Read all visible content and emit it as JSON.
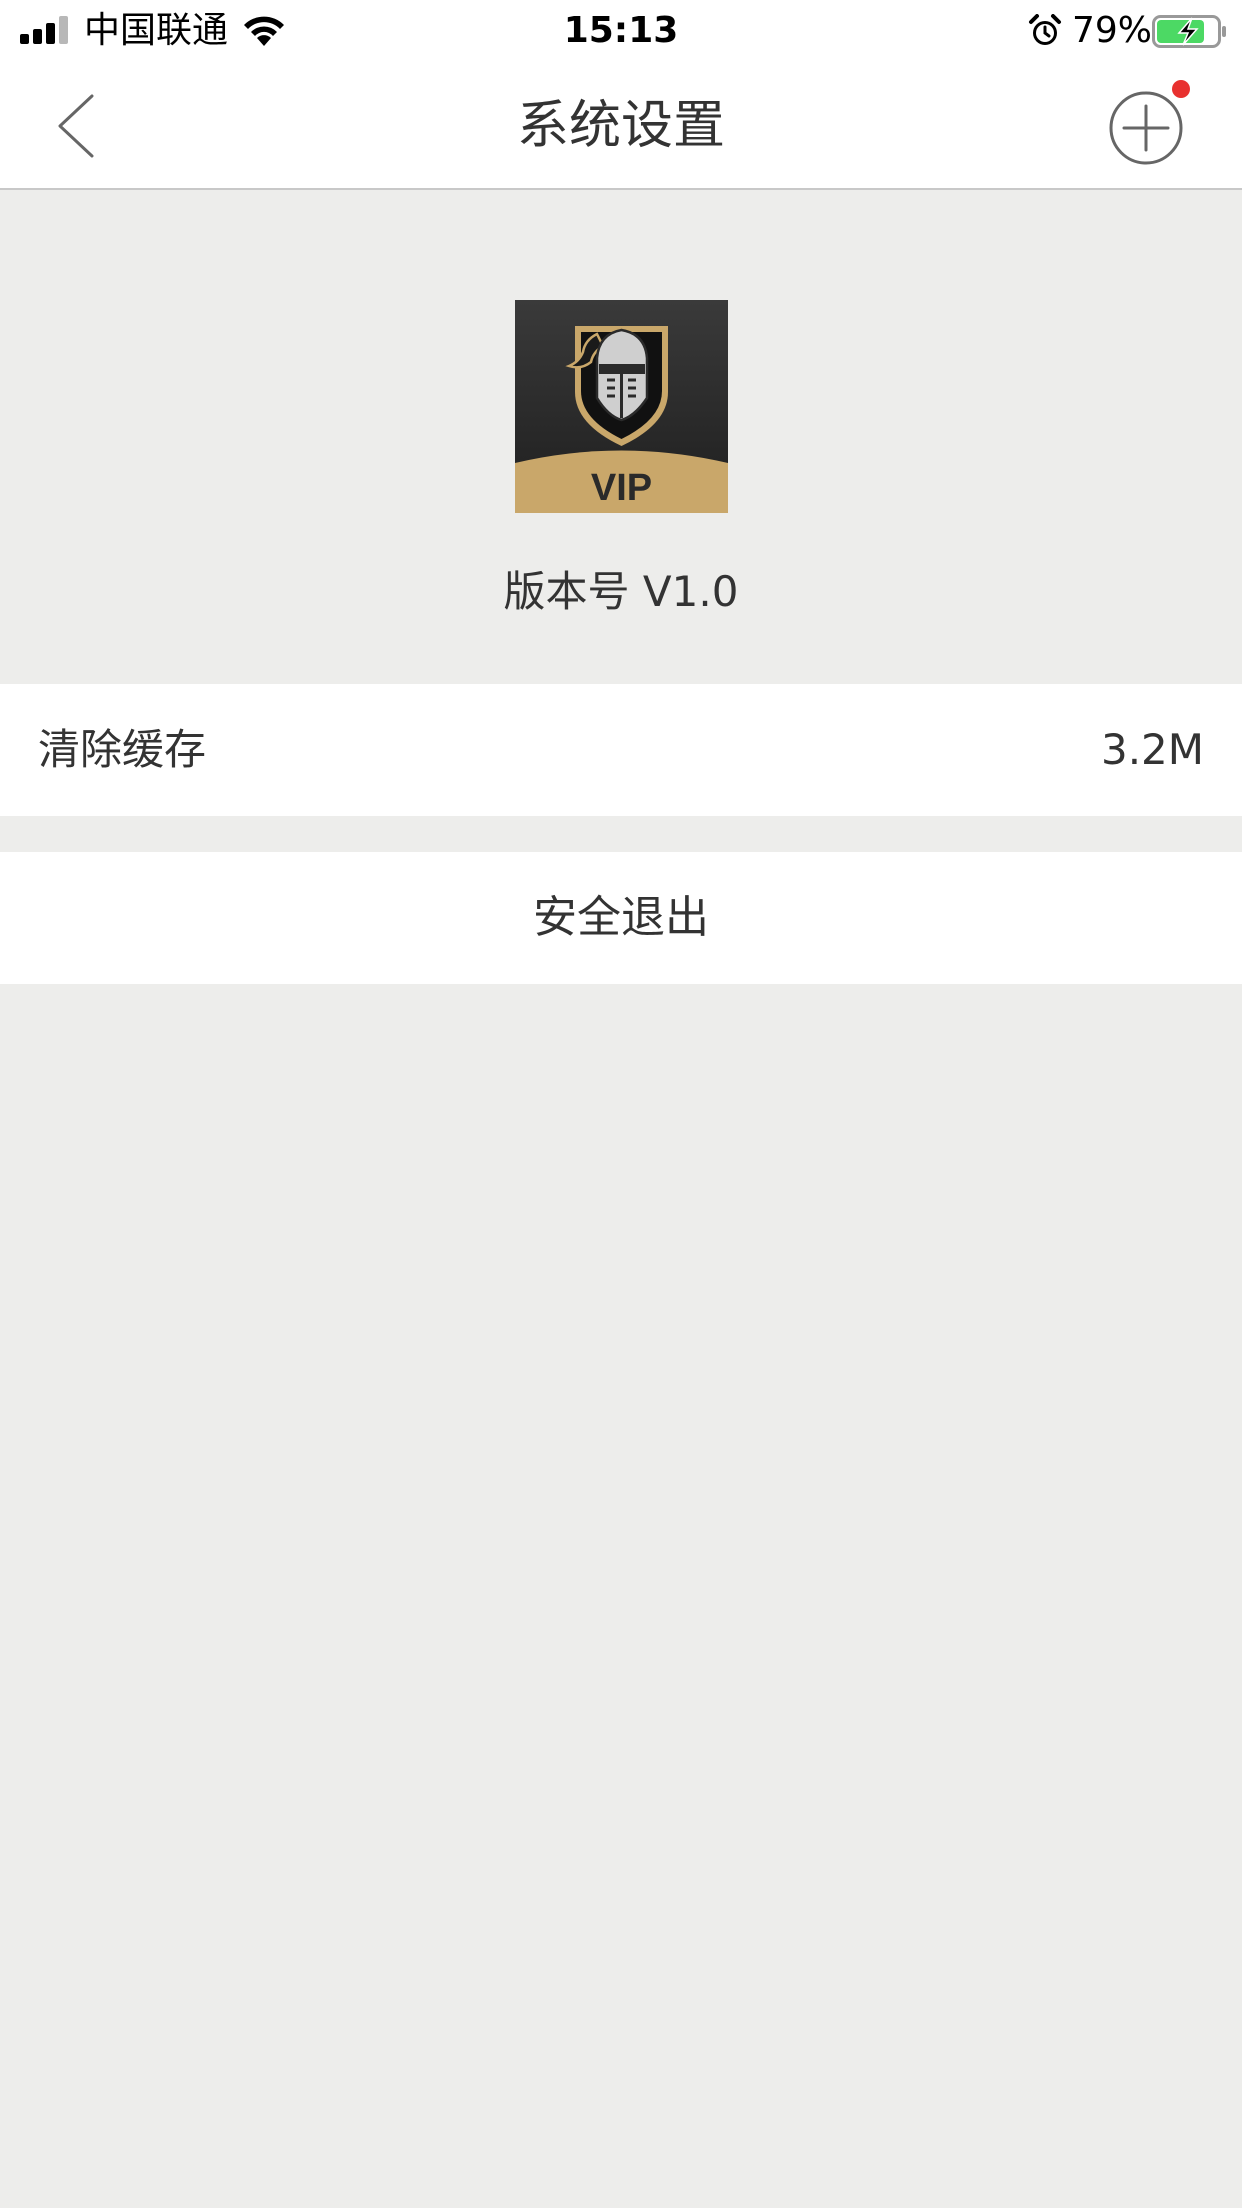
{
  "status_bar": {
    "carrier": "中国联通",
    "time": "15:13",
    "battery_percent": "79%",
    "battery_level": 0.79,
    "signal_icon": "cellular-signal-icon",
    "wifi_icon": "wifi-icon",
    "alarm_icon": "alarm-clock-icon",
    "battery_icon": "battery-charging-icon",
    "battery_color": "#4cd964"
  },
  "nav": {
    "title": "系统设置",
    "back_icon": "chevron-left-icon",
    "add_icon": "plus-circle-icon",
    "notification_dot_color": "#e8312f"
  },
  "app_info": {
    "logo_text": "VIP",
    "logo_icon": "knight-helmet-icon",
    "logo_colors": {
      "background": "#2c2c2c",
      "gold": "#c9a76a"
    },
    "version": "版本号 V1.0"
  },
  "settings": {
    "clear_cache_label": "清除缓存",
    "cache_size": "3.2M",
    "logout_label": "安全退出"
  },
  "colors": {
    "page_background": "#ededeb",
    "row_background": "#ffffff",
    "text": "#333333"
  }
}
